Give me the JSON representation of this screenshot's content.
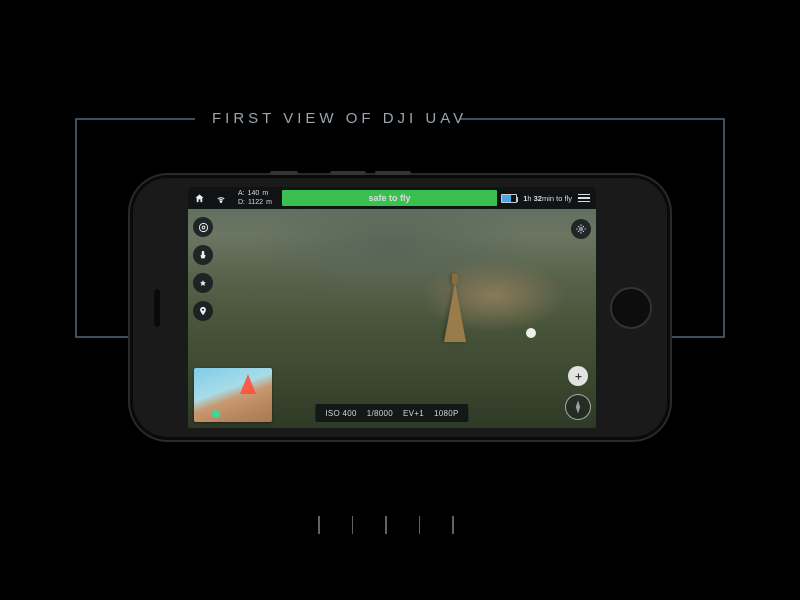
{
  "title": "FIRST VIEW OF DJI UAV",
  "topbar": {
    "altitude": {
      "label": "A:",
      "value": "140",
      "unit": "m"
    },
    "distance": {
      "label": "D:",
      "value": "1122",
      "unit": "m"
    },
    "status": "safe to fly",
    "flight_time": {
      "hours": "1",
      "hours_unit": "h",
      "minutes": "32",
      "suffix": "min to fly"
    }
  },
  "camera": {
    "iso": "ISO 400",
    "shutter": "1/8000",
    "ev": "EV+1",
    "res": "1080P"
  },
  "icons": {
    "home": "home",
    "signal": "signal",
    "battery": "battery",
    "menu": "menu",
    "gimbal": "gimbal",
    "gesture": "gesture",
    "tracking": "tracking",
    "poi": "poi",
    "capture": "capture",
    "record": "record",
    "compass": "compass"
  }
}
